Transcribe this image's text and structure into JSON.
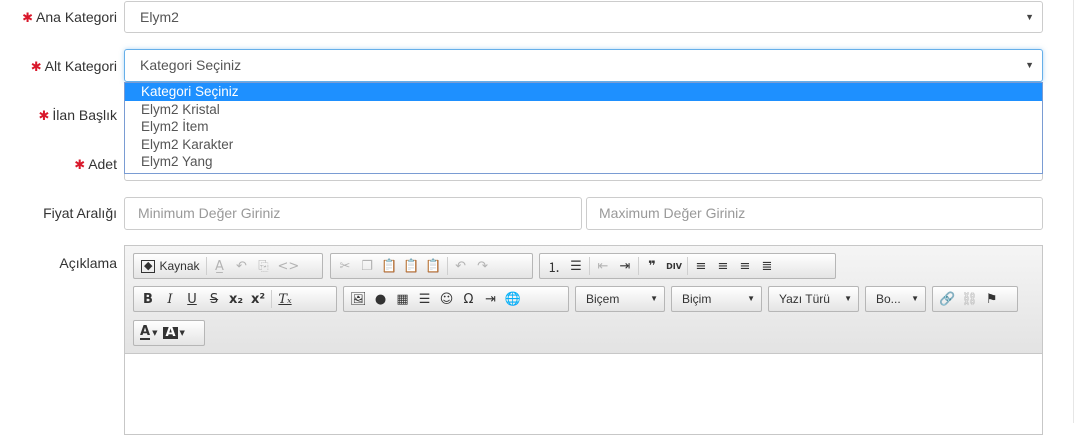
{
  "form": {
    "required_mark": "✱",
    "ana_kategori": {
      "label": "Ana Kategori",
      "value": "Elym2"
    },
    "alt_kategori": {
      "label": "Alt Kategori",
      "value": "Kategori Seçiniz"
    },
    "ilan_baslik": {
      "label": "İlan Başlık"
    },
    "adet": {
      "label": "Adet"
    },
    "fiyat_araligi": {
      "label": "Fiyat Aralığı",
      "min_placeholder": "Minimum Değer Giriniz",
      "max_placeholder": "Maximum Değer Giriniz"
    },
    "aciklama": {
      "label": "Açıklama"
    }
  },
  "dropdown": {
    "options": [
      "Kategori Seçiniz",
      "Elym2 Kristal",
      "Elym2 İtem",
      "Elym2 Karakter",
      "Elym2 Yang"
    ],
    "selected": "Kategori Seçiniz"
  },
  "editor": {
    "source_label": "Kaynak",
    "styles_label": "Biçem",
    "format_label": "Biçim",
    "font_label": "Yazı Türü",
    "size_label": "Bo...",
    "icons": {
      "row1": [
        "source-icon",
        "remove-format-icon",
        "undo-style-icon",
        "paste-style-icon",
        "code-icon",
        "cut-icon",
        "copy-icon",
        "paste-icon",
        "paste-text-icon",
        "paste-word-icon",
        "undo-icon",
        "redo-icon",
        "numbered-list-icon",
        "bulleted-list-icon",
        "outdent-icon",
        "indent-icon",
        "blockquote-icon",
        "div-icon",
        "align-left-icon",
        "align-center-icon",
        "align-right-icon",
        "justify-icon"
      ],
      "row2": [
        "bold-icon",
        "italic-icon",
        "underline-icon",
        "strikethrough-icon",
        "subscript-icon",
        "superscript-icon",
        "clear-format-icon",
        "image-icon",
        "flash-icon",
        "table-icon",
        "horizontal-line-icon",
        "smiley-icon",
        "omega-icon",
        "page-break-icon",
        "iframe-icon",
        "link-icon",
        "unlink-icon",
        "anchor-icon"
      ],
      "row3": [
        "text-color-icon",
        "background-color-icon"
      ]
    }
  }
}
